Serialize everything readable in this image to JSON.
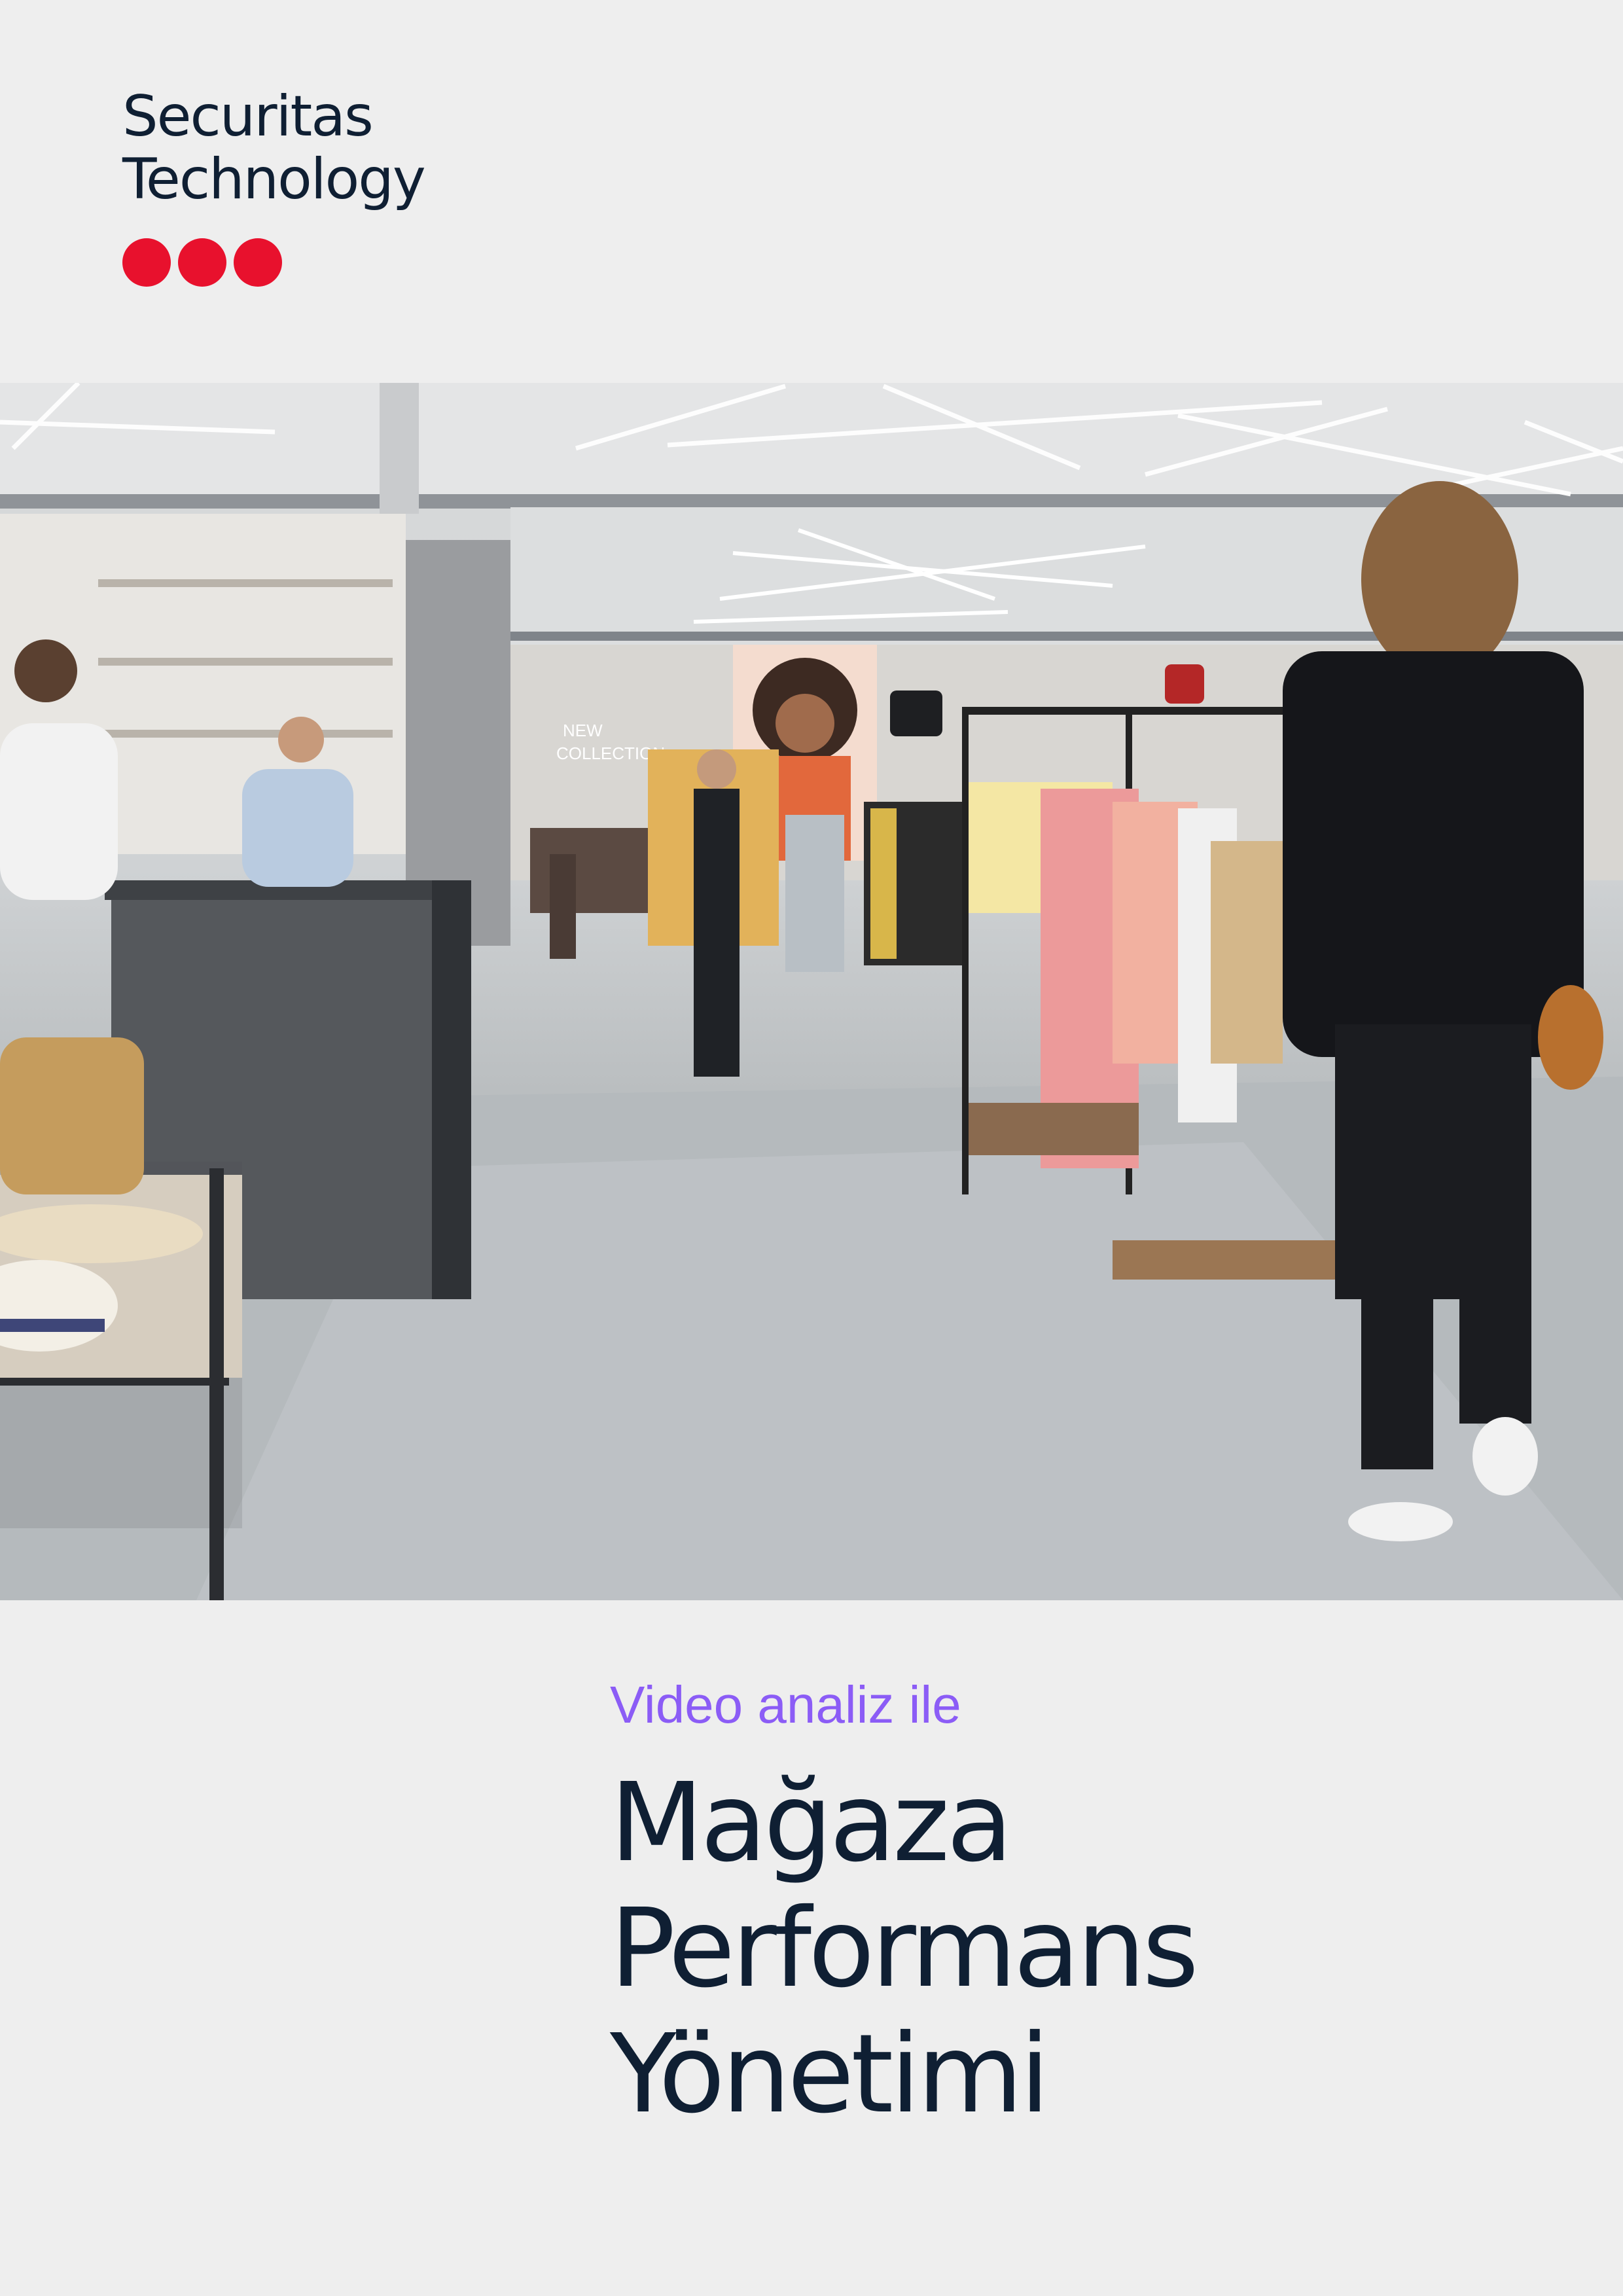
{
  "brand": {
    "line1": "Securitas",
    "line2": "Technology",
    "dot_color": "#e8112d",
    "text_color": "#0f1f33"
  },
  "photo": {
    "signage_text": [
      "NEW",
      "COLLECTION"
    ]
  },
  "cover": {
    "subtitle": "Video analiz ile",
    "subtitle_color": "#8b5cf6",
    "title_lines": [
      "Mağaza",
      "Performans",
      "Yönetimi"
    ]
  }
}
